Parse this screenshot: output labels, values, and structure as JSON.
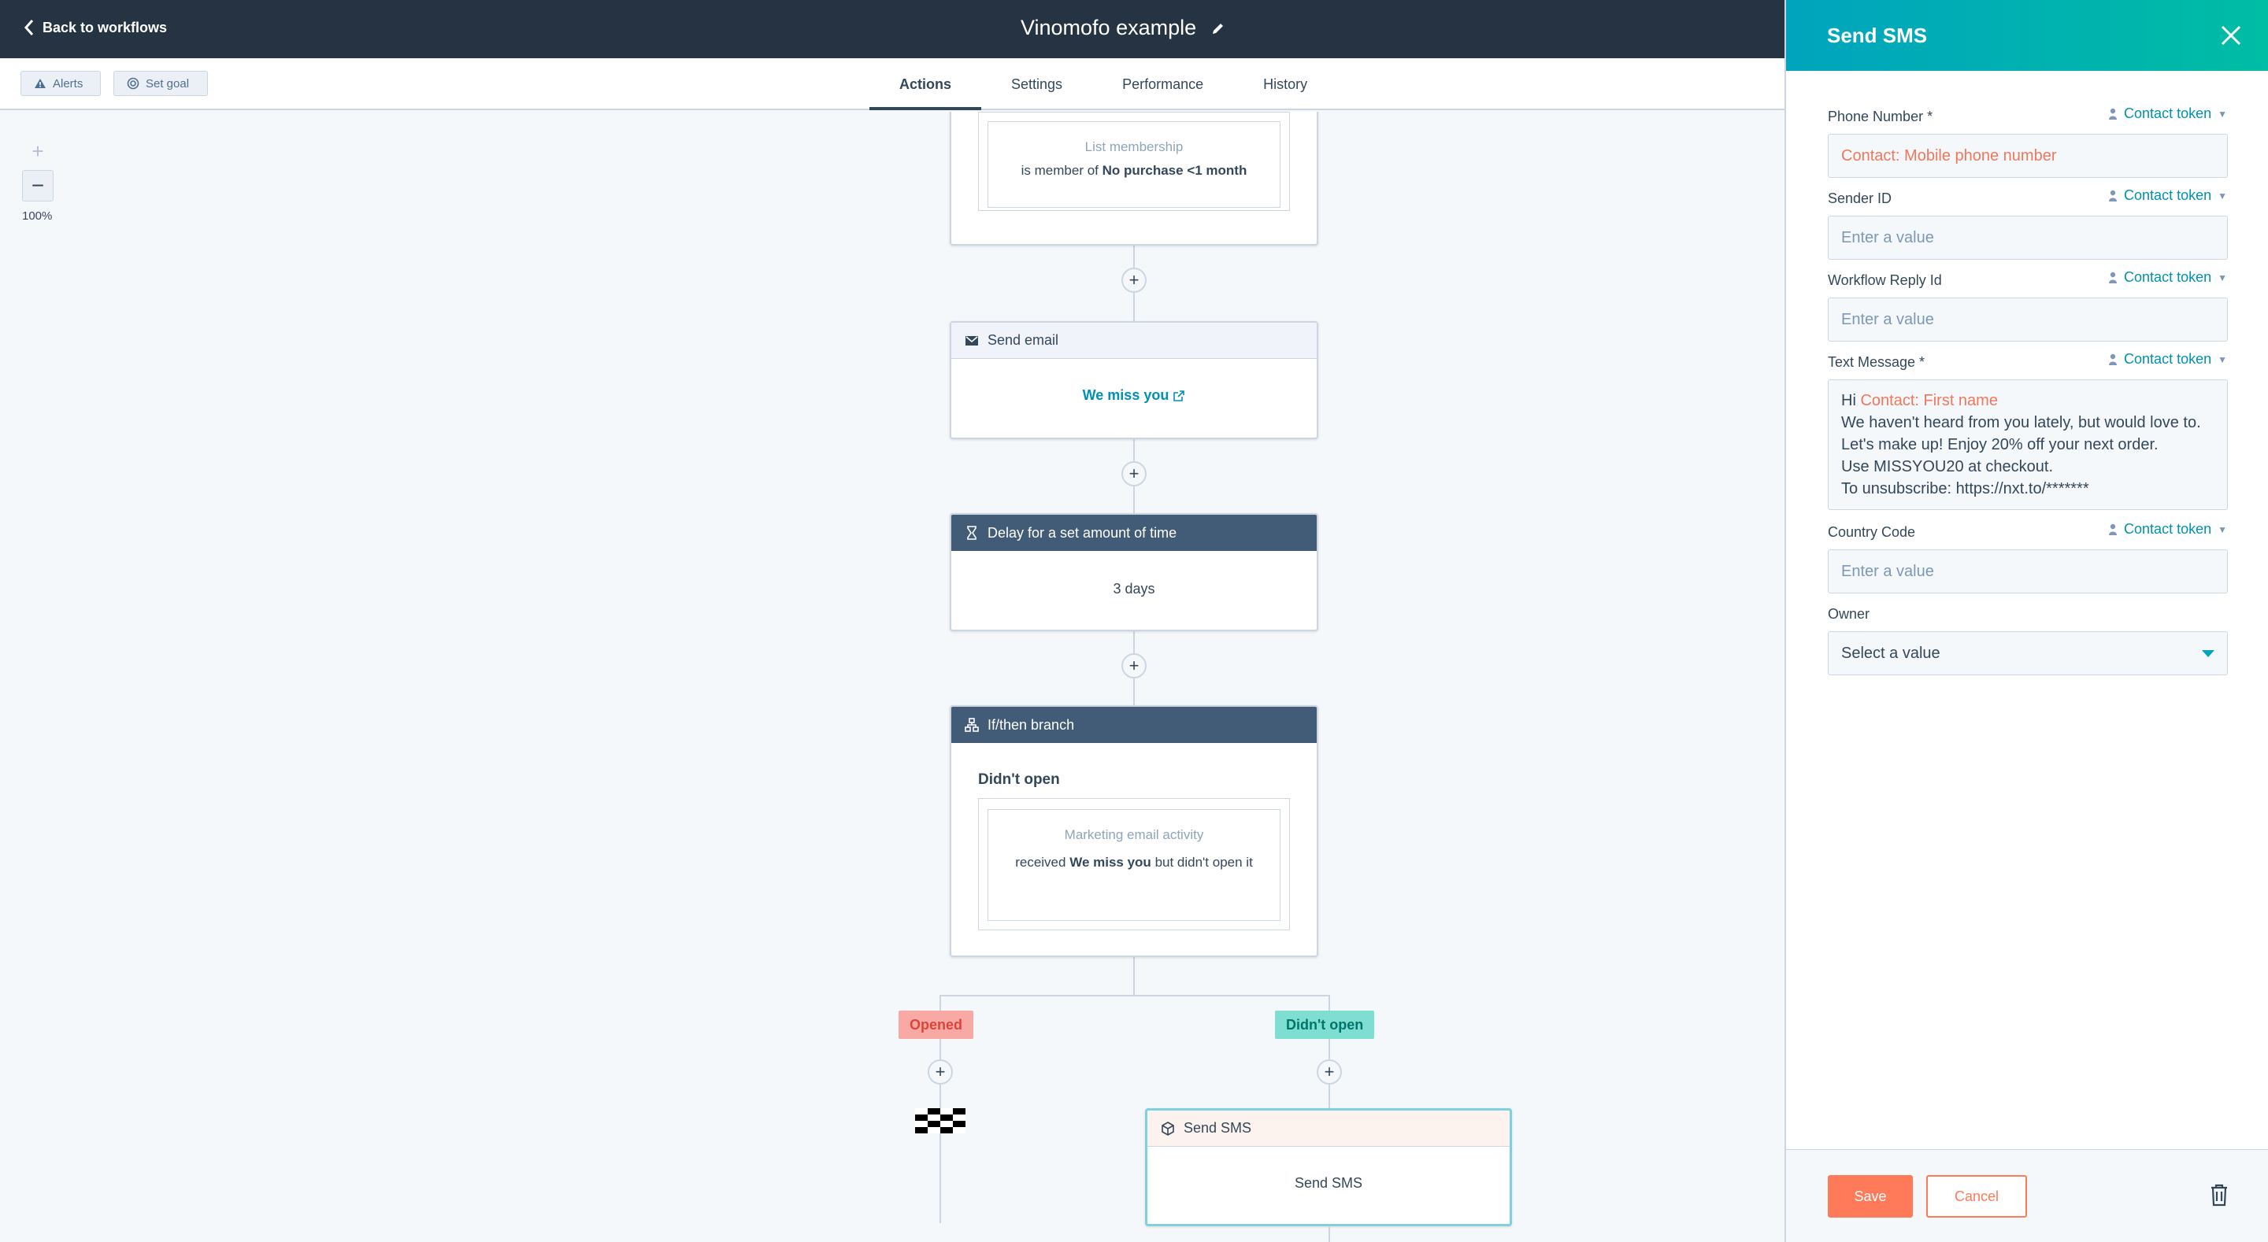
{
  "header": {
    "back_label": "Back to workflows",
    "title": "Vinomofo example"
  },
  "toolbar": {
    "alerts_label": "Alerts",
    "set_goal_label": "Set goal"
  },
  "tabs": [
    {
      "label": "Actions",
      "active": true
    },
    {
      "label": "Settings",
      "active": false
    },
    {
      "label": "Performance",
      "active": false
    },
    {
      "label": "History",
      "active": false
    }
  ],
  "zoom": {
    "level": "100%"
  },
  "workflow": {
    "list_card": {
      "title": "List membership",
      "text_prefix": "is member of",
      "text_bold": "No purchase <1 month"
    },
    "email_card": {
      "header": "Send email",
      "link": "We miss you"
    },
    "delay_card": {
      "header": "Delay for a set amount of time",
      "value": "3 days"
    },
    "branch_card": {
      "header": "If/then branch",
      "branch_name": "Didn't open",
      "criteria_title": "Marketing email activity",
      "criteria_prefix": "received",
      "criteria_bold": "We miss you",
      "criteria_suffix": "but didn't open it"
    },
    "branches": {
      "opened": "Opened",
      "didnt_open": "Didn't open"
    },
    "sms_card": {
      "header": "Send SMS",
      "body": "Send SMS"
    }
  },
  "panel": {
    "title": "Send SMS",
    "token_label": "Contact token",
    "fields": {
      "phone": {
        "label": "Phone Number *",
        "value": "Contact: Mobile phone number"
      },
      "sender": {
        "label": "Sender ID",
        "placeholder": "Enter a value"
      },
      "reply": {
        "label": "Workflow Reply Id",
        "placeholder": "Enter a value"
      },
      "message": {
        "label": "Text Message *",
        "greeting": "Hi",
        "token": "Contact: First name",
        "line1": "We haven't heard from you lately, but would love to. Let's make up! Enjoy 20% off your next order.",
        "line2": "Use MISSYOU20 at checkout.",
        "line3": "To unsubscribe: https://nxt.to/*******"
      },
      "country": {
        "label": "Country Code",
        "placeholder": "Enter a value"
      },
      "owner": {
        "label": "Owner",
        "placeholder": "Select a value"
      }
    },
    "save_label": "Save",
    "cancel_label": "Cancel"
  },
  "colors": {
    "topbar": "#253342",
    "accent": "#00a4bd",
    "primary": "#ff7a59",
    "opened_tag": "#f8a9a3",
    "didnt_open_tag": "#7fded2"
  }
}
